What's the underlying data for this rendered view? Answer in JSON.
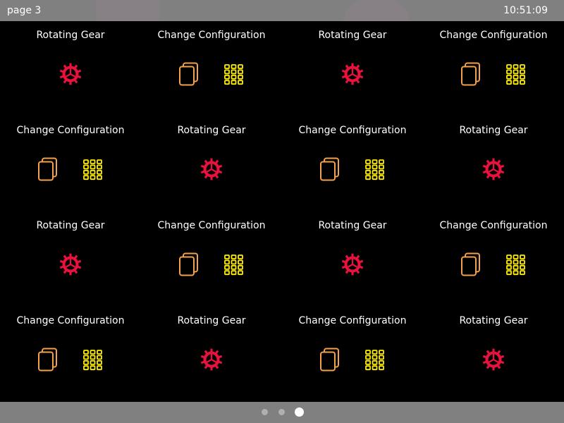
{
  "status_bar": {
    "page_label": "page 3",
    "clock": "10:51:09"
  },
  "colors": {
    "gear": "#e8123c",
    "pages": "#f5a04a",
    "apps": "#ffee00",
    "bar": "#808080",
    "background": "#000000"
  },
  "tiles": [
    {
      "title": "Rotating Gear",
      "icons": [
        "gear-icon"
      ]
    },
    {
      "title": "Change Configuration",
      "icons": [
        "pages-icon",
        "apps-icon"
      ]
    },
    {
      "title": "Rotating Gear",
      "icons": [
        "gear-icon"
      ]
    },
    {
      "title": "Change Configuration",
      "icons": [
        "pages-icon",
        "apps-icon"
      ]
    },
    {
      "title": "Change Configuration",
      "icons": [
        "pages-icon",
        "apps-icon"
      ]
    },
    {
      "title": "Rotating Gear",
      "icons": [
        "gear-icon"
      ]
    },
    {
      "title": "Change Configuration",
      "icons": [
        "pages-icon",
        "apps-icon"
      ]
    },
    {
      "title": "Rotating Gear",
      "icons": [
        "gear-icon"
      ]
    },
    {
      "title": "Rotating Gear",
      "icons": [
        "gear-icon"
      ]
    },
    {
      "title": "Change Configuration",
      "icons": [
        "pages-icon",
        "apps-icon"
      ]
    },
    {
      "title": "Rotating Gear",
      "icons": [
        "gear-icon"
      ]
    },
    {
      "title": "Change Configuration",
      "icons": [
        "pages-icon",
        "apps-icon"
      ]
    },
    {
      "title": "Change Configuration",
      "icons": [
        "pages-icon",
        "apps-icon"
      ]
    },
    {
      "title": "Rotating Gear",
      "icons": [
        "gear-icon"
      ]
    },
    {
      "title": "Change Configuration",
      "icons": [
        "pages-icon",
        "apps-icon"
      ]
    },
    {
      "title": "Rotating Gear",
      "icons": [
        "gear-icon"
      ]
    }
  ],
  "pager": {
    "page_count": 3,
    "current_page": 3
  }
}
